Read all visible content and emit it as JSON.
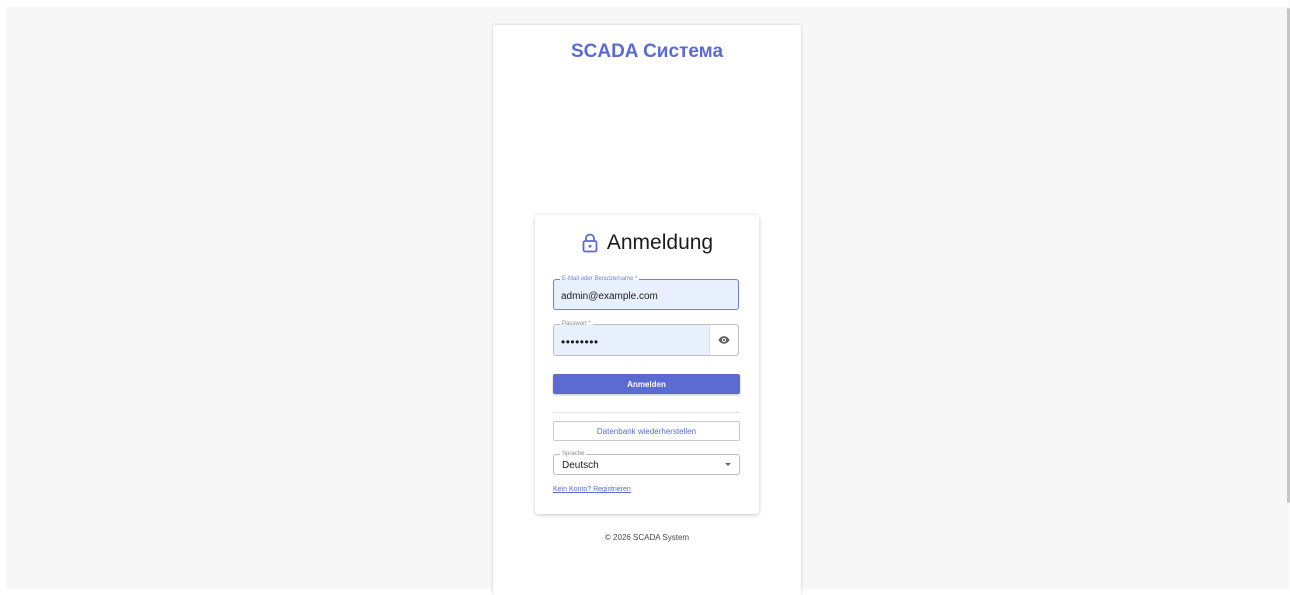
{
  "header": {
    "app_title": "SCADA Система"
  },
  "login": {
    "heading": "Anmeldung",
    "email": {
      "label": "E-Mail oder Benutzername *",
      "value": "admin@example.com"
    },
    "password": {
      "label": "Passwort *",
      "value": "••••••••"
    },
    "submit_label": "Anmelden",
    "restore_label": "Datenbank wiederherstellen",
    "language": {
      "label": "Sprache",
      "selected": "Deutsch"
    },
    "register_link": "Kein Konto? Registrieren"
  },
  "footer": {
    "copyright": "© 2026 SCADA System"
  },
  "colors": {
    "accent": "#5c6bd2",
    "input_fill": "#e8effd",
    "background": "#f7f7f7"
  },
  "icons": {
    "lock": "lock-icon",
    "visibility": "eye-icon",
    "dropdown": "caret-down-icon"
  }
}
